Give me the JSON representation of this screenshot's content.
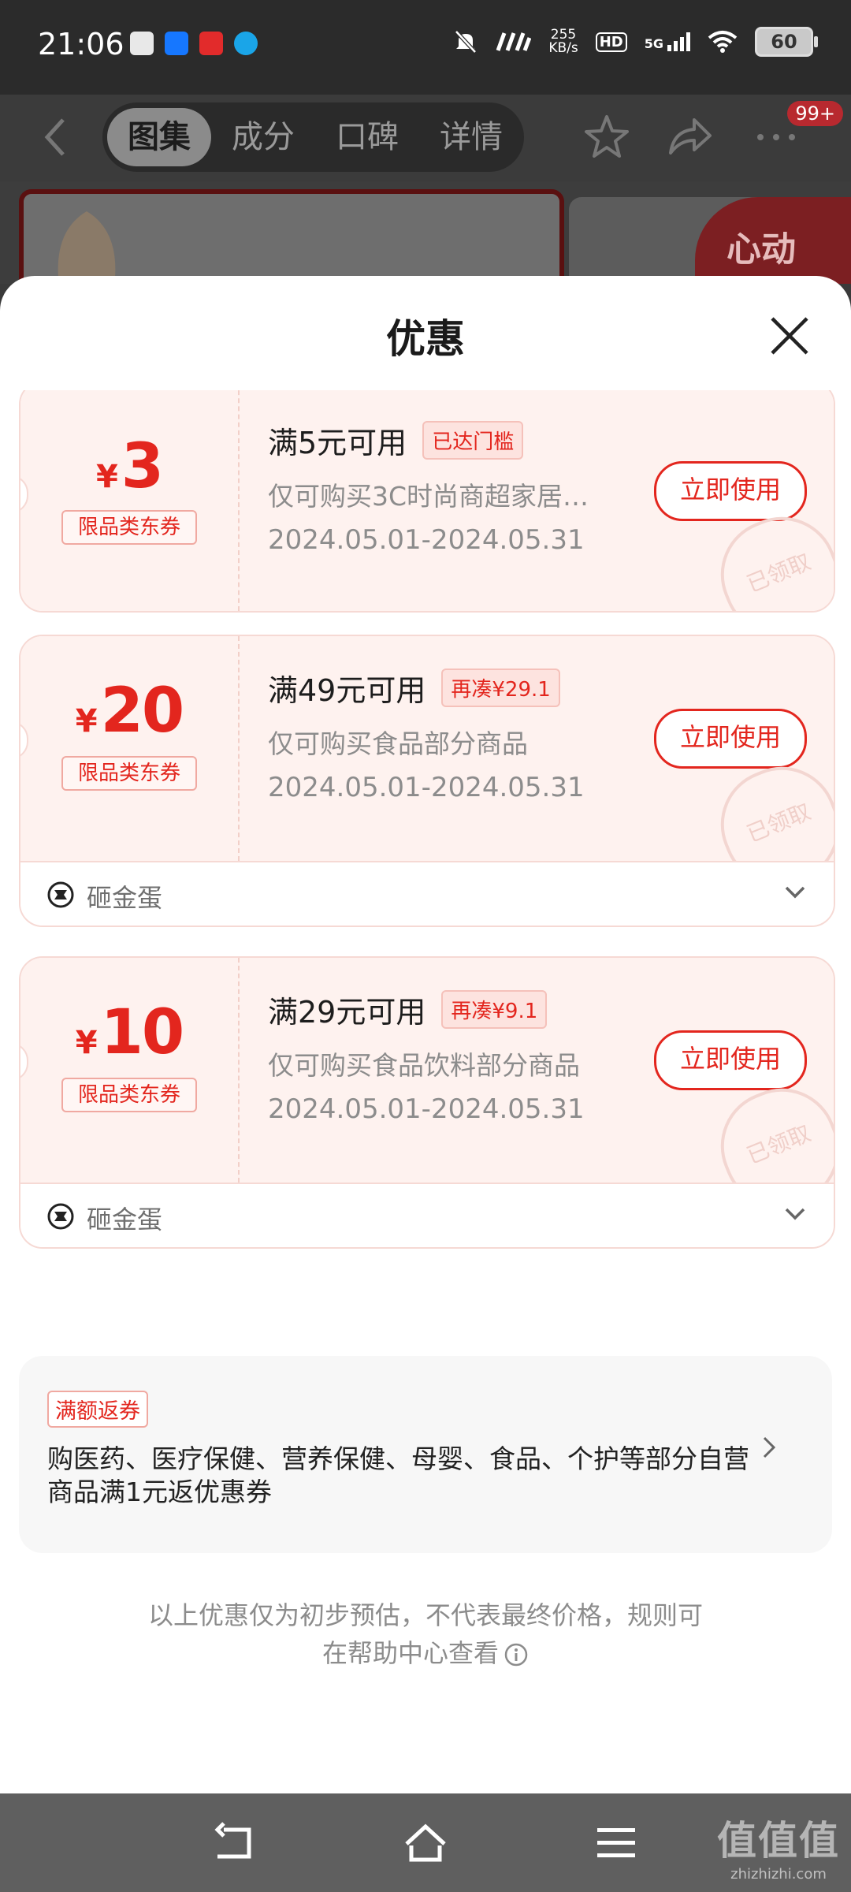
{
  "status_bar": {
    "time": "21:06",
    "net_speed_value": "255",
    "net_speed_unit": "KB/s",
    "hd_label": "HD",
    "network_label": "5G",
    "battery": "60"
  },
  "header": {
    "tabs": [
      {
        "label": "图集",
        "active": true
      },
      {
        "label": "成分",
        "active": false
      },
      {
        "label": "口碑",
        "active": false
      },
      {
        "label": "详情",
        "active": false
      }
    ],
    "badge": "99+"
  },
  "product_promo": "心动",
  "sheet": {
    "title": "优惠",
    "coupons": [
      {
        "currency": "¥",
        "amount": "3",
        "type": "限品类东券",
        "threshold": "满5元可用",
        "status": "已达门槛",
        "scope": "仅可购买3C时尚商超家居…",
        "period": "2024.05.01-2024.05.31",
        "button": "立即使用",
        "stamp": "已领取"
      },
      {
        "currency": "¥",
        "amount": "20",
        "type": "限品类东券",
        "threshold": "满49元可用",
        "status": "再凑¥29.1",
        "scope": "仅可购买食品部分商品",
        "period": "2024.05.01-2024.05.31",
        "button": "立即使用",
        "stamp": "已领取",
        "footer": "砸金蛋"
      },
      {
        "currency": "¥",
        "amount": "10",
        "type": "限品类东券",
        "threshold": "满29元可用",
        "status": "再凑¥9.1",
        "scope": "仅可购买食品饮料部分商品",
        "period": "2024.05.01-2024.05.31",
        "button": "立即使用",
        "stamp": "已领取",
        "footer": "砸金蛋"
      }
    ],
    "rebate": {
      "tag": "满额返券",
      "text": "购医药、医疗保健、营养保健、母婴、食品、个护等部分自营商品满1元返优惠券"
    },
    "disclaimer_line1": "以上优惠仅为初步预估，不代表最终价格，规则可",
    "disclaimer_line2": "在帮助中心查看"
  },
  "watermark": {
    "big": "值值值",
    "small": "zhizhizhi.com"
  },
  "colors": {
    "accent": "#e3261e",
    "coupon_bg": "#fef2ef",
    "sheet_bg": "#ffffff",
    "nav_bg": "#5f5f5f"
  },
  "icons": [
    "back-icon",
    "star-icon",
    "share-icon",
    "more-icon",
    "close-icon",
    "egg-icon",
    "chevron-down-icon",
    "chevron-right-icon",
    "info-icon",
    "nav-back-icon",
    "nav-home-icon",
    "nav-menu-icon"
  ]
}
